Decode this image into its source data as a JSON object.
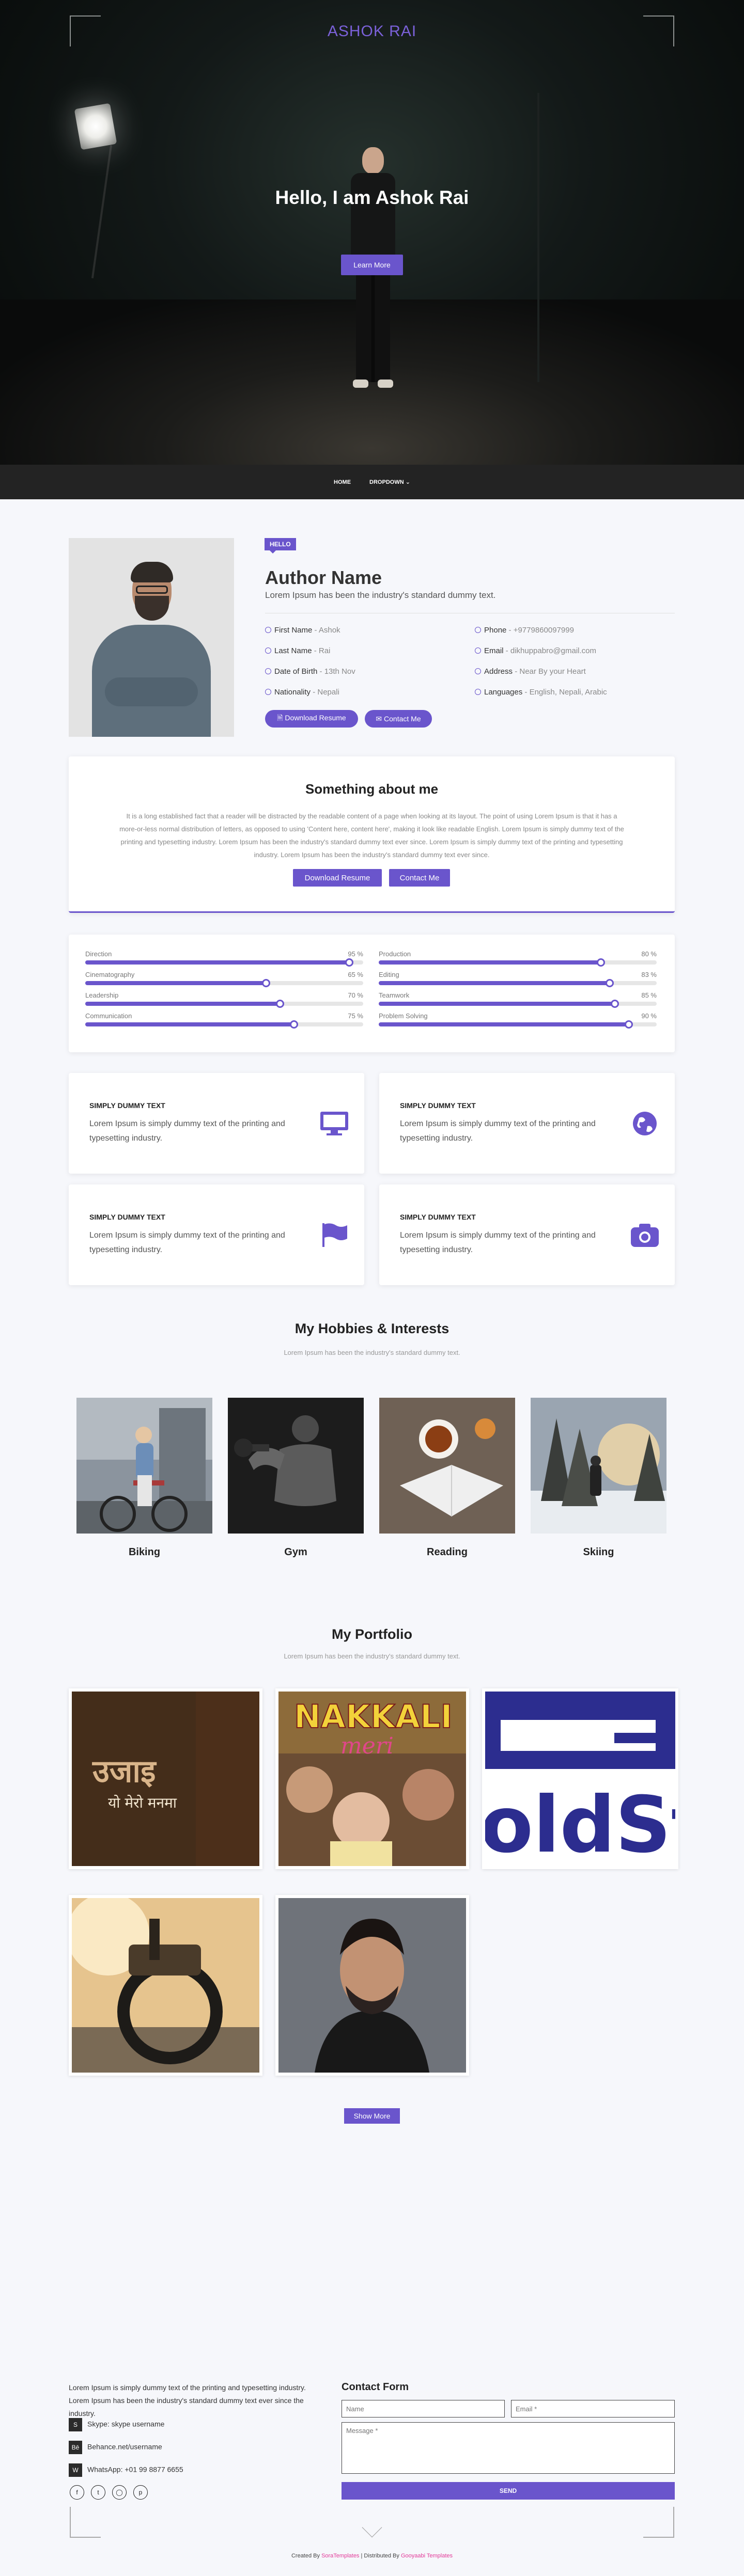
{
  "header": {
    "brand": "ASHOK RAI",
    "hero_title": "Hello, I am Ashok Rai",
    "hero_button": "Learn More"
  },
  "nav": {
    "items": [
      {
        "label": "HOME"
      },
      {
        "label": "DROPDOWN ⌄"
      }
    ]
  },
  "profile": {
    "badge": "HELLO",
    "name": "Author Name",
    "subtitle": "Lorem Ipsum has been the industry's standard dummy text.",
    "info": [
      {
        "label": "First Name",
        "value": " - Ashok"
      },
      {
        "label": "Phone",
        "value": " - +9779860097999"
      },
      {
        "label": "Last Name",
        "value": " - Rai"
      },
      {
        "label": "Email",
        "value": " - dikhuppabro@gmail.com"
      },
      {
        "label": "Date of Birth",
        "value": " - 13th Nov"
      },
      {
        "label": "Address",
        "value": " - Near By your Heart"
      },
      {
        "label": "Nationality",
        "value": " - Nepali"
      },
      {
        "label": "Languages",
        "value": " - English, Nepali, Arabic"
      }
    ],
    "download_label": "Download Resume",
    "contact_label": "Contact Me"
  },
  "about": {
    "title": "Something about me",
    "text": "It is a long established fact that a reader will be distracted by the readable content of a page when looking at its layout. The point of using Lorem Ipsum is that it has a more-or-less normal distribution of letters, as opposed to using 'Content here, content here', making it look like readable English. Lorem Ipsum is simply dummy text of the printing and typesetting industry. Lorem Ipsum has been the industry's standard dummy text ever since. Lorem Ipsum is simply dummy text of the printing and typesetting industry. Lorem Ipsum has been the industry's standard dummy text ever since.",
    "download_label": "Download Resume",
    "contact_label": "Contact Me"
  },
  "skills": [
    {
      "name": "Direction",
      "value": 95,
      "label": "95 %"
    },
    {
      "name": "Production",
      "value": 80,
      "label": "80 %"
    },
    {
      "name": "Cinematography",
      "value": 65,
      "label": "65 %"
    },
    {
      "name": "Editing",
      "value": 83,
      "label": "83 %"
    },
    {
      "name": "Leadership",
      "value": 70,
      "label": "70 %"
    },
    {
      "name": "Teamwork",
      "value": 85,
      "label": "85 %"
    },
    {
      "name": "Communication",
      "value": 75,
      "label": "75 %"
    },
    {
      "name": "Problem Solving",
      "value": 90,
      "label": "90 %"
    }
  ],
  "services": [
    {
      "title": "SIMPLY DUMMY TEXT",
      "text": "Lorem Ipsum is simply dummy text of the printing and typesetting industry.",
      "icon": "monitor-icon"
    },
    {
      "title": "SIMPLY DUMMY TEXT",
      "text": "Lorem Ipsum is simply dummy text of the printing and typesetting industry.",
      "icon": "globe-icon"
    },
    {
      "title": "SIMPLY DUMMY TEXT",
      "text": "Lorem Ipsum is simply dummy text of the printing and typesetting industry.",
      "icon": "flag-icon"
    },
    {
      "title": "SIMPLY DUMMY TEXT",
      "text": "Lorem Ipsum is simply dummy text of the printing and typesetting industry.",
      "icon": "camera-icon"
    }
  ],
  "hobbies": {
    "title": "My Hobbies & Interests",
    "subtitle": "Lorem Ipsum has been the industry's standard dummy text.",
    "items": [
      {
        "label": "Biking"
      },
      {
        "label": "Gym"
      },
      {
        "label": "Reading"
      },
      {
        "label": "Skiing"
      }
    ]
  },
  "portfolio": {
    "title": "My Portfolio",
    "subtitle": "Lorem Ipsum has been the industry's standard dummy text.",
    "poster_title": "उजाइ",
    "poster_sub": "यो मेरो मनमा",
    "nakkali_title": "NAKKALI",
    "nakkali_sub": "meri",
    "logo_text": "oldSt",
    "show_more": "Show More"
  },
  "footer": {
    "text": "Lorem Ipsum is simply dummy text of the printing and typesetting industry. Lorem Ipsum has been the industry's standard dummy text ever since the industry.",
    "skype": "Skype: skype username",
    "behance": "Behance.net/username",
    "whatsapp": "WhatsApp: +01 99 8877 6655",
    "contact_title": "Contact Form",
    "name_placeholder": "Name",
    "email_placeholder": "Email *",
    "message_placeholder": "Message *",
    "send_label": "SEND",
    "credit_prefix": "Created By ",
    "credit_author": "SoraTemplates",
    "credit_mid": " | Distributed By ",
    "credit_dist": "Gooyaabi Templates"
  },
  "colors": {
    "accent": "#6a55cc",
    "hero_bg": "#0b0f0e",
    "nav_bg": "#232323",
    "page_bg": "#f6f7fb"
  }
}
